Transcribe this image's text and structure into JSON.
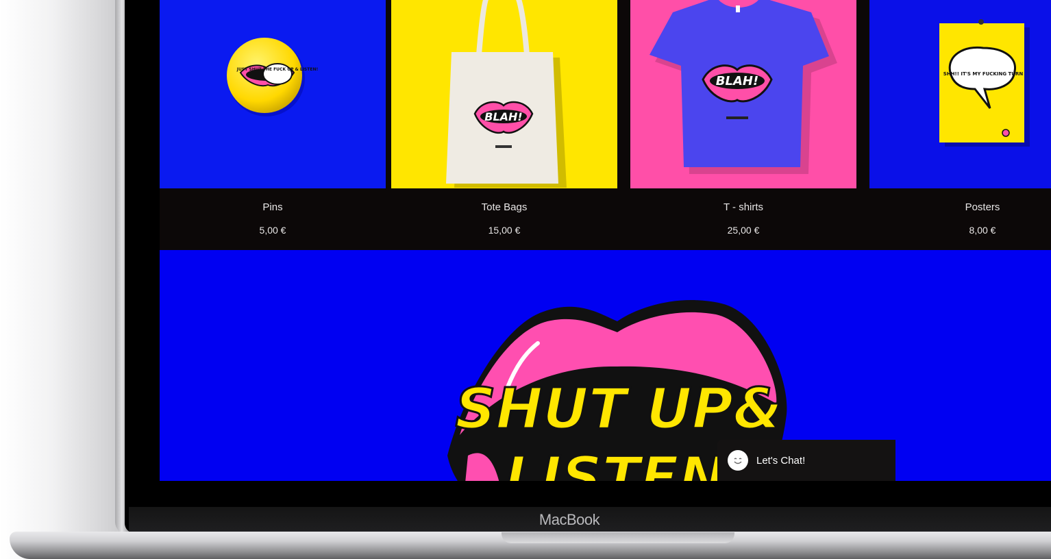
{
  "device": {
    "brand": "MacBook"
  },
  "products": [
    {
      "title": "Pins",
      "price": "5,00 €",
      "bg": "#0a1af0",
      "artwork_text": "JUST SHUT THE FUCK UP & LISTEN!"
    },
    {
      "title": "Tote Bags",
      "price": "15,00 €",
      "bg": "#ffe600",
      "artwork_text": "BLAH!"
    },
    {
      "title": "T - shirts",
      "price": "25,00 €",
      "bg": "#ff4fa8",
      "artwork_text": "BLAH!"
    },
    {
      "title": "Posters",
      "price": "8,00 €",
      "bg": "#0a10e8",
      "artwork_text": "SHH!! IT'S MY FUCKING TURN"
    }
  ],
  "hero": {
    "bg": "#0000f2",
    "lips_color": "#ff4fb0",
    "text_color": "#ffe600",
    "line1": "SHUT UP&",
    "line2": "LISTEN"
  },
  "chat": {
    "label": "Let's Chat!",
    "icon": "smiley-icon"
  }
}
